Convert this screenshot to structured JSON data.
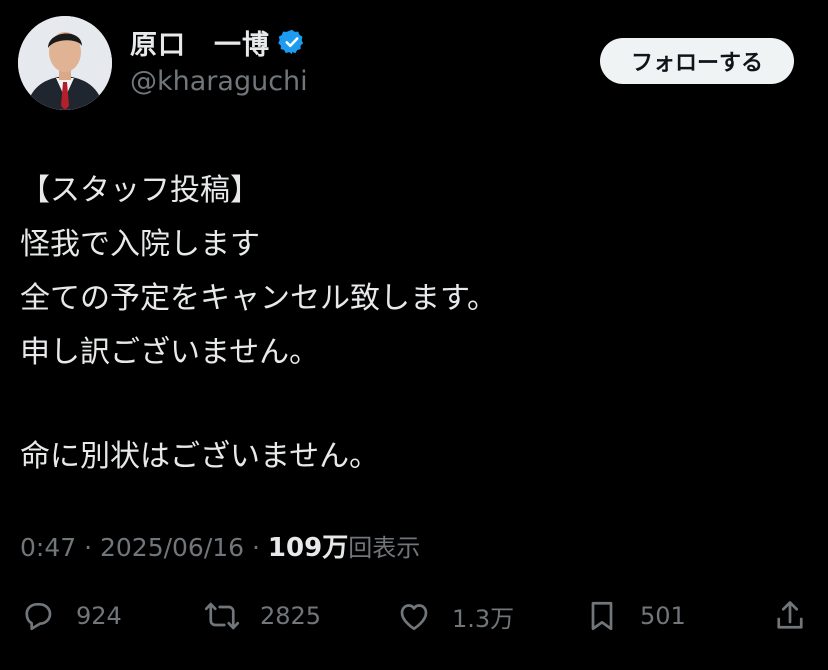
{
  "author": {
    "display_name": "原口　一博",
    "handle": "@kharaguchi",
    "verified_color": "#1d9bf0"
  },
  "follow_button": {
    "label": "フォローする"
  },
  "post": {
    "lines": [
      "【スタッフ投稿】",
      "怪我で入院します",
      "全ての予定をキャンセル致します。",
      "申し訳ございません。",
      "",
      "命に別状はございません。"
    ]
  },
  "meta": {
    "time": "0:47",
    "separator1": " · ",
    "date": "2025/06/16",
    "separator2": " · ",
    "views_count": "109万",
    "views_label": "回表示"
  },
  "actions": {
    "replies": {
      "icon": "reply-icon",
      "count": "924"
    },
    "reposts": {
      "icon": "repost-icon",
      "count": "2825"
    },
    "likes": {
      "icon": "like-icon",
      "count": "1.3万"
    },
    "bookmarks": {
      "icon": "bookmark-icon",
      "count": "501"
    },
    "share": {
      "icon": "share-icon"
    }
  }
}
